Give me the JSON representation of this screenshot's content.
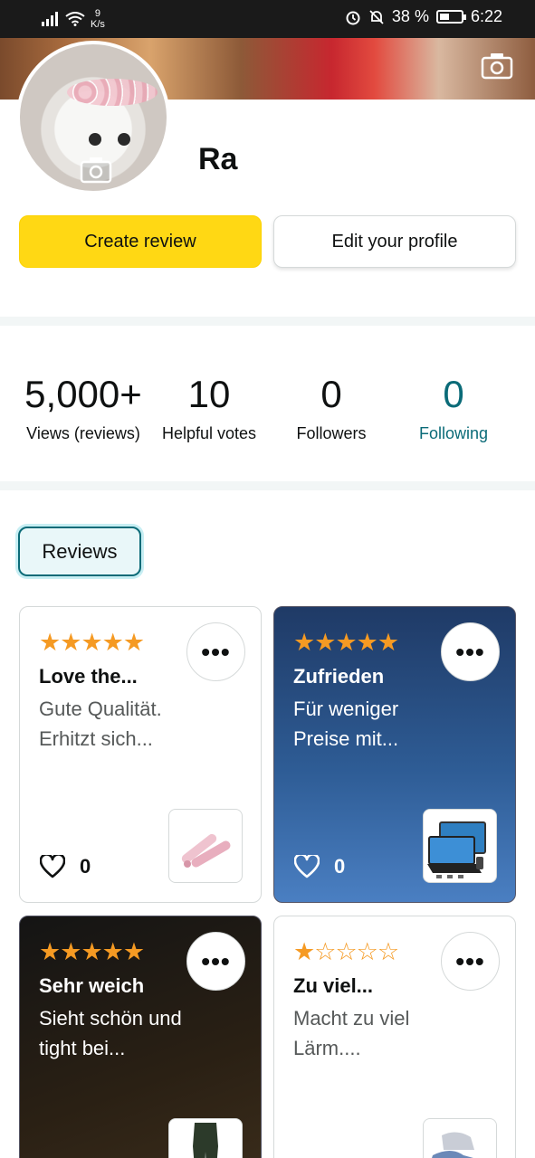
{
  "status_bar": {
    "net_speed_value": "9",
    "net_speed_unit": "K/s",
    "battery": "38 %",
    "time": "6:22"
  },
  "profile": {
    "name": "Ra",
    "create_review_label": "Create review",
    "edit_profile_label": "Edit your profile"
  },
  "stats": [
    {
      "value": "5,000+",
      "label": "Views (reviews)"
    },
    {
      "value": "10",
      "label": "Helpful votes"
    },
    {
      "value": "0",
      "label": "Followers"
    },
    {
      "value": "0",
      "label": "Following"
    }
  ],
  "tabs": {
    "reviews_label": "Reviews"
  },
  "review_cards": [
    {
      "rating": 5,
      "title": "Love the...",
      "body": "Gute Qualität. Erhitzt sich...",
      "likes": "0",
      "thumb_icon": "hair-straightener-image",
      "theme": "light"
    },
    {
      "rating": 5,
      "title": "Zufrieden",
      "body": "Für weniger Preise mit...",
      "likes": "0",
      "thumb_icon": "tablet-keyboard-image",
      "theme": "blue"
    },
    {
      "rating": 5,
      "title": "Sehr weich",
      "body": "Sieht schön und tight bei...",
      "likes": "",
      "thumb_icon": "leggings-image",
      "theme": "black"
    },
    {
      "rating": 1,
      "title": "Zu viel...",
      "body": "Macht zu viel Lärm....",
      "likes": "",
      "thumb_icon": "shoes-image",
      "theme": "light"
    }
  ],
  "colors": {
    "primary_button": "#ffd814",
    "accent_teal": "#0b6b78",
    "star": "#f59a23"
  }
}
